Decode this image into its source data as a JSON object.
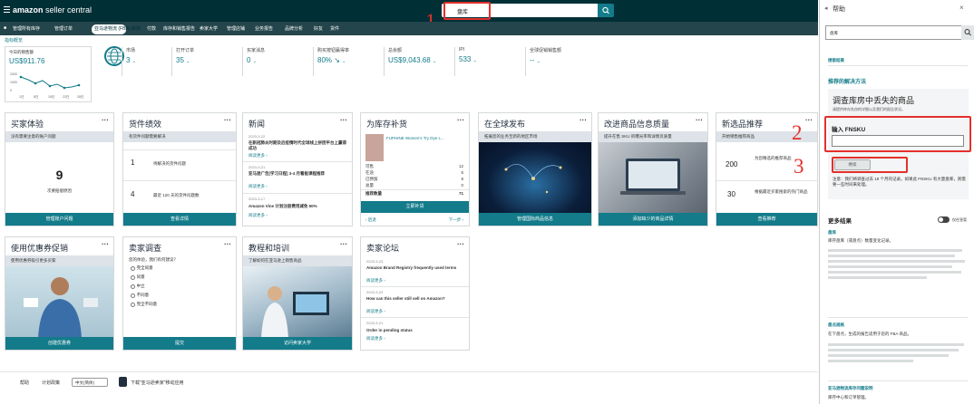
{
  "header": {
    "logo_brand": "amazon",
    "logo_product": "seller central",
    "search_value": "盘库",
    "nav": [
      "管理所有库存",
      "管理订单",
      "亚马逊物流 (FBA) 库存",
      "付款",
      "库存和销售报告",
      "卖家大学",
      "管理店铺",
      "业务报告",
      "品牌分析",
      "好友",
      "货件"
    ],
    "nav_active_index": 2
  },
  "metrics": {
    "title": "指标概览",
    "sales_label": "今日的销售额",
    "sales_value": "US$911.76",
    "chart_y": [
      "2000",
      "1000",
      "0"
    ],
    "chart_x": [
      "1日",
      "8日",
      "15日",
      "22日",
      "28日"
    ],
    "items": [
      {
        "label": "市场",
        "value": "3"
      },
      {
        "label": "打开订单",
        "value": "35"
      },
      {
        "label": "买家消息",
        "value": "0"
      },
      {
        "label": "购买按钮赢得率",
        "value": "80% ↘"
      },
      {
        "label": "总余额",
        "value": "US$9,043.68"
      },
      {
        "label": "IPI",
        "value": "533"
      },
      {
        "label": "全球促销销售额",
        "value": "--"
      }
    ]
  },
  "cards": {
    "buyer": {
      "title": "买家体验",
      "band": "没有需要注意的账户问题",
      "number": "9",
      "sub": "次要赔偿原因",
      "button": "管理账户问题"
    },
    "shipment": {
      "title": "货件绩效",
      "band": "有货件问题需要解决",
      "rows": [
        {
          "num": "1",
          "text": "待解决的货件问题"
        },
        {
          "num": "4",
          "text": "最近 120 天的货件问题数"
        }
      ],
      "button": "查看详情"
    },
    "news": {
      "title": "新闻",
      "items": [
        {
          "date": "2023-3-22",
          "title": "在新冠肺炎时期及后疫情时代全球线上拼团平台上赢得成功",
          "more": "阅读更多 ›"
        },
        {
          "date": "2023-3-21",
          "title": "亚马逊广告[学习日程] 3-4 月看板课程推荐",
          "more": "阅读更多 ›"
        },
        {
          "date": "2023-3-17",
          "title": "Amazon Vine 计划注册费用减免 50%",
          "more": "阅读更多 ›"
        }
      ]
    },
    "restock": {
      "title": "为库存补货",
      "product": "FUPHINE Women's Try Dye L...",
      "rows": [
        {
          "label": "可售",
          "value": "12"
        },
        {
          "label": "在途",
          "value": "5"
        },
        {
          "label": "已预留",
          "value": "8"
        },
        {
          "label": "总量",
          "value": "0"
        },
        {
          "label": "推荐数量",
          "value": "71"
        }
      ],
      "button": "立即补货",
      "prev": "‹ 后退",
      "next": "下一步 ›"
    },
    "global": {
      "title": "在全球发布",
      "band": "拓展您的业务至新的地区市场",
      "button": "管理国际商品信息"
    },
    "listing": {
      "title": "改进商品信息质量",
      "band": "提升在售 SKU 的曝光率和详情页质量",
      "button": "添加缺少的商品详情"
    },
    "recommend": {
      "title": "新选品推荐",
      "band": "开始销售推荐商品",
      "rows": [
        {
          "num": "200",
          "text": "为您精选的推荐商品"
        },
        {
          "num": "30",
          "text": "根据最近买家搜索的热门商品"
        }
      ],
      "button": "查看推荐"
    },
    "promo": {
      "title": "使用优惠券促销",
      "band": "使用优惠券吸引更多买家",
      "button": "创建优惠券"
    },
    "survey": {
      "title": "卖家调查",
      "question": "您的体验，我们有何建议？",
      "options": [
        "完全同意",
        "同意",
        "中立",
        "不同意",
        "完全不同意"
      ],
      "button": "提交"
    },
    "training": {
      "title": "教程和培训",
      "band": "了解如何在亚马逊上销售商品",
      "button": "访问卖家大学"
    },
    "forum": {
      "title": "卖家论坛",
      "items": [
        {
          "date": "2023-3-23",
          "title": "Amazon Brand Registry frequently used terms",
          "more": "阅读更多 ›"
        },
        {
          "date": "2023-3-22",
          "title": "How can this seller still sell on Amazon?",
          "more": "阅读更多 ›"
        },
        {
          "date": "2023-3-21",
          "title": "Order in pending status",
          "more": "阅读更多 ›"
        }
      ]
    }
  },
  "footer": {
    "help": "帮助",
    "policy": "计划政策",
    "language": "中文(简体)",
    "app": "下载\"亚马逊卖家\"移动应用"
  },
  "help_panel": {
    "title": "帮助",
    "search_value": "盘库",
    "results_label": "搜索结果",
    "recommended": "推荐的解决方法",
    "box_title": "调查库房中丢失的商品",
    "box_sub": "请提供库存失窃的详细以及我们的报告状况。",
    "fnsku_label": "输入 FNSKU",
    "submit": "继续",
    "note": "注意：我们将调查过去 18 个月的记录。如果此 FNSKU 有大量盘库，则需要一些时间来处理。",
    "more_results": "更多结果",
    "toggle_label": "仅在答案",
    "results": [
      {
        "title": "盘库",
        "text": "库存盘库（或盘点）数量变化记录。"
      },
      {
        "title": "盘点规格",
        "text": "在下盘点，生成的报告适用于您的 FBA 商品。"
      },
      {
        "title": "亚马逊物流库存问题说明",
        "text": "库存中心和订单管理。"
      }
    ]
  },
  "annotations": {
    "n1": "1",
    "n2": "2",
    "n3": "3"
  },
  "colors": {
    "dark_nav": "#002f36",
    "teal": "#137b8a",
    "red": "#e3302b"
  }
}
